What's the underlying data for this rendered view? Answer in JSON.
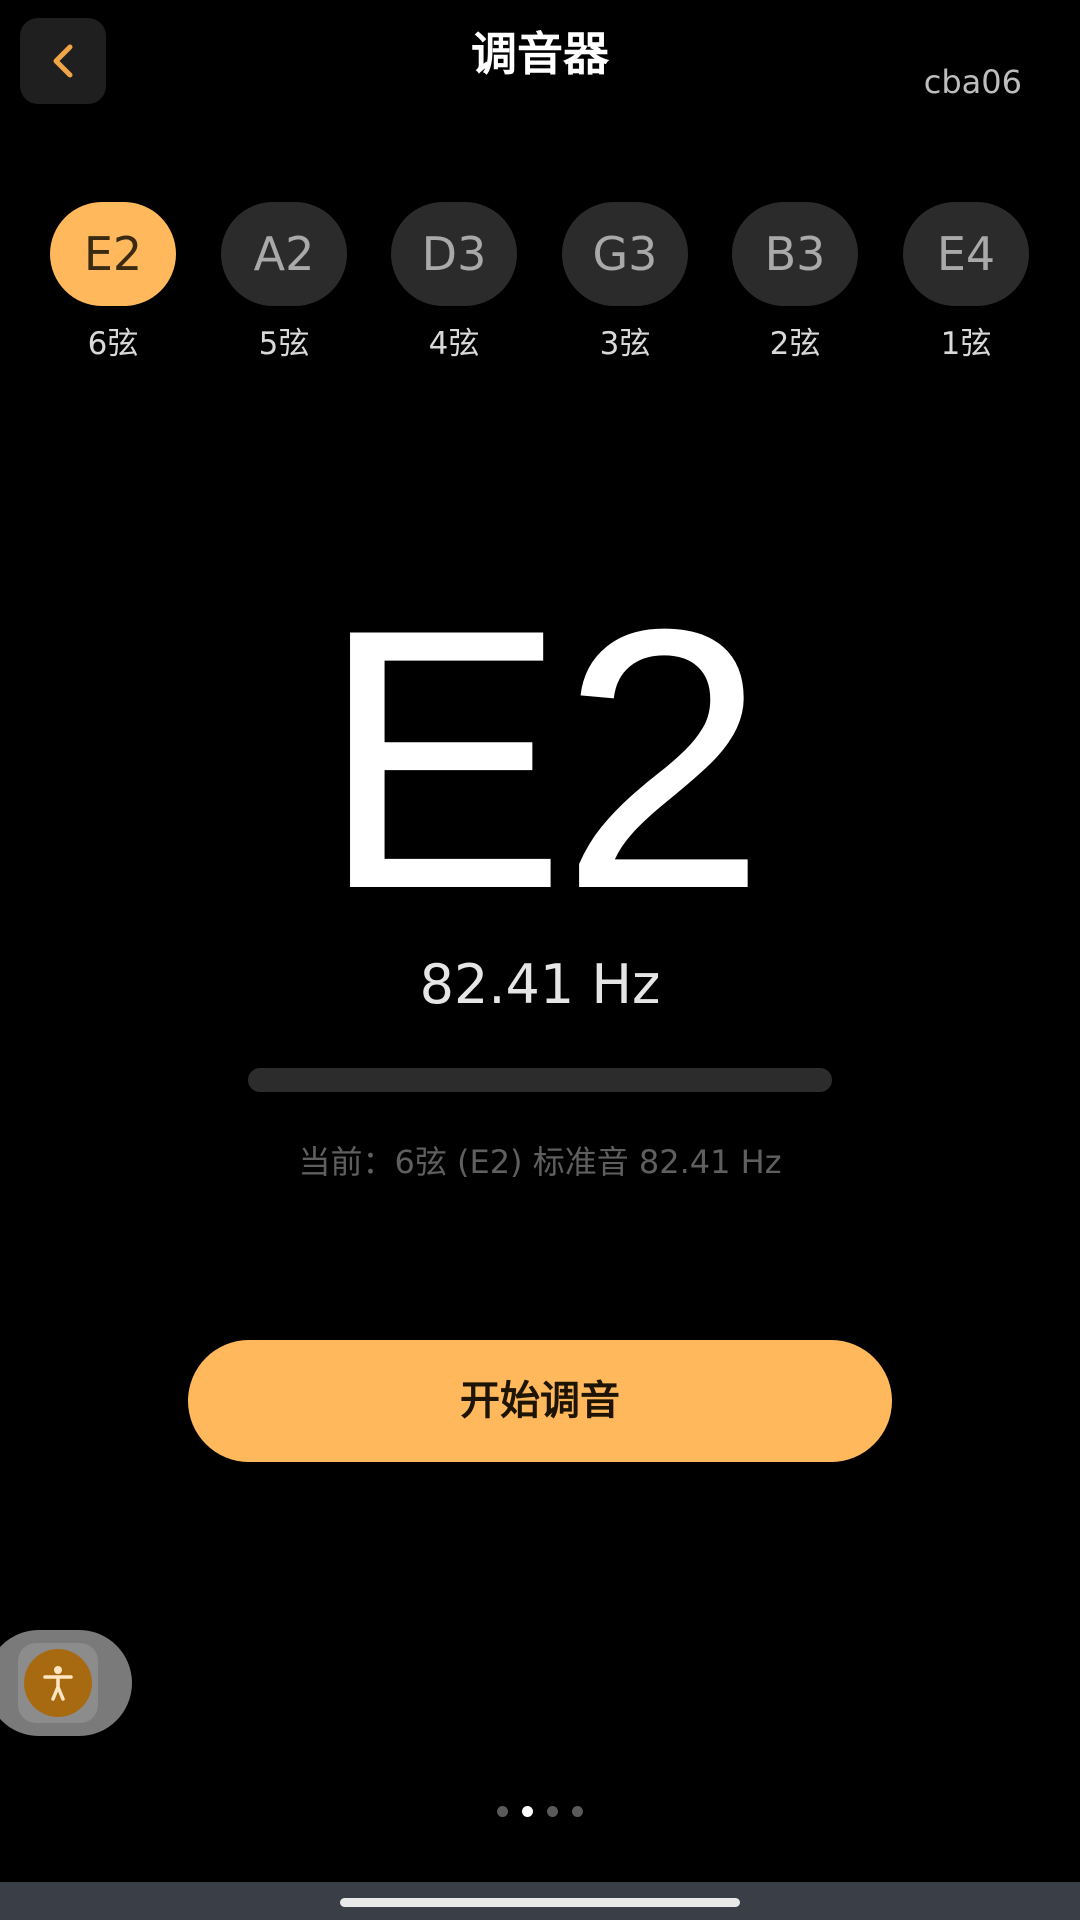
{
  "header": {
    "title": "调音器",
    "user_tag": "cba06",
    "back_icon": "chevron-left-icon"
  },
  "strings": [
    {
      "note": "E2",
      "label": "6弦",
      "active": true
    },
    {
      "note": "A2",
      "label": "5弦",
      "active": false
    },
    {
      "note": "D3",
      "label": "4弦",
      "active": false
    },
    {
      "note": "G3",
      "label": "3弦",
      "active": false
    },
    {
      "note": "B3",
      "label": "2弦",
      "active": false
    },
    {
      "note": "E4",
      "label": "1弦",
      "active": false
    }
  ],
  "display": {
    "note": "E2",
    "frequency": "82.41 Hz",
    "pitch_level": 0,
    "current_info": "当前：6弦 (E2) 标准音 82.41 Hz"
  },
  "actions": {
    "start_label": "开始调音"
  },
  "accessibility": {
    "icon": "accessibility-icon"
  },
  "pager": {
    "count": 4,
    "active_index": 1
  },
  "colors": {
    "accent": "#ffb95c",
    "background": "#000000",
    "pill_inactive": "#2b2b2b"
  }
}
